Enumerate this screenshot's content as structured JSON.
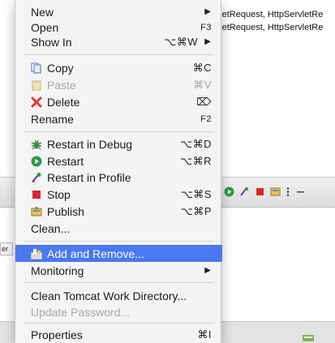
{
  "background": {
    "code_lines": [
      "rvletRequest, HttpServletRe",
      "rvletRequest, HttpServletRe"
    ],
    "server_tab_glyph": "er"
  },
  "menu": {
    "items": [
      {
        "label": "New",
        "shortcut": "",
        "submenu": true
      },
      {
        "label": "Open",
        "shortcut": "F3"
      },
      {
        "label": "Show In",
        "shortcut": "⌥⌘W",
        "submenu": true
      },
      {
        "label": "Copy",
        "shortcut": "⌘C",
        "icon": "copy-icon"
      },
      {
        "label": "Paste",
        "shortcut": "⌘V",
        "icon": "paste-icon",
        "disabled": true
      },
      {
        "label": "Delete",
        "shortcut": "⌦",
        "icon": "delete-icon"
      },
      {
        "label": "Rename",
        "shortcut": "F2"
      },
      {
        "label": "Restart in Debug",
        "shortcut": "⌥⌘D",
        "icon": "debug-icon"
      },
      {
        "label": "Restart",
        "shortcut": "⌥⌘R",
        "icon": "run-icon"
      },
      {
        "label": "Restart in Profile",
        "shortcut": "",
        "icon": "profile-icon"
      },
      {
        "label": "Stop",
        "shortcut": "⌥⌘S",
        "icon": "stop-icon"
      },
      {
        "label": "Publish",
        "shortcut": "⌥⌘P",
        "icon": "publish-icon"
      },
      {
        "label": "Clean...",
        "shortcut": ""
      },
      {
        "label": "Add and Remove...",
        "shortcut": "",
        "icon": "add-remove-icon",
        "highlighted": true
      },
      {
        "label": "Monitoring",
        "shortcut": "",
        "submenu": true
      },
      {
        "label": "Clean Tomcat Work Directory...",
        "shortcut": ""
      },
      {
        "label": "Update Password...",
        "shortcut": "",
        "disabled": true
      },
      {
        "label": "Properties",
        "shortcut": "⌘I"
      }
    ]
  },
  "colors": {
    "highlight": "#4a78f0",
    "delete_red": "#e03a2f",
    "run_green": "#2f9a45",
    "stop_red": "#d9262c"
  }
}
